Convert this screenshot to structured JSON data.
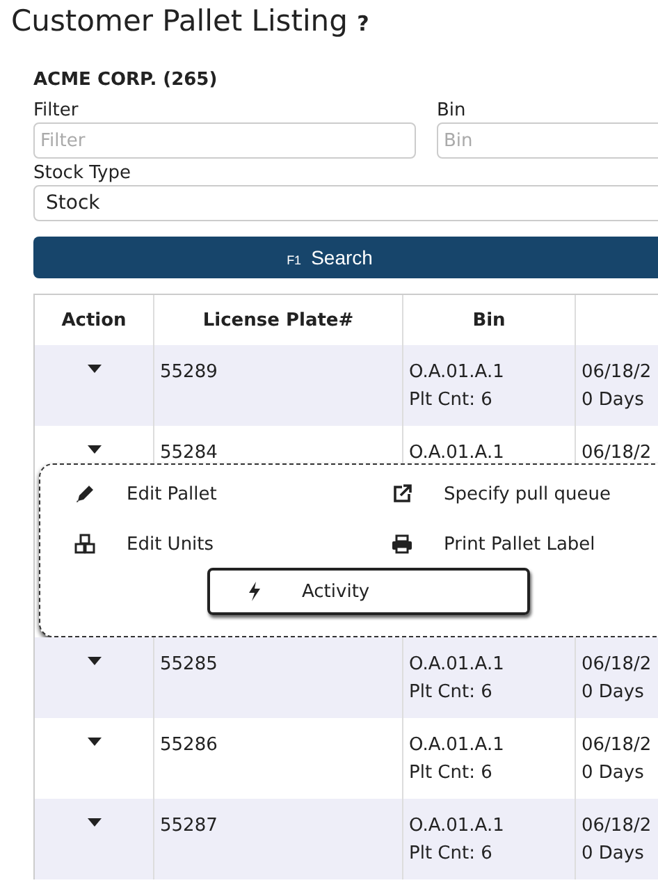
{
  "title": "Customer Pallet Listing",
  "help": "?",
  "customer": "ACME CORP. (265)",
  "filters": {
    "filter": {
      "label": "Filter",
      "placeholder": "Filter"
    },
    "bin": {
      "label": "Bin",
      "placeholder": "Bin"
    },
    "stock_type": {
      "label": "Stock Type",
      "value": "Stock"
    }
  },
  "search_button": {
    "key": "F1",
    "label": "Search"
  },
  "table": {
    "columns": [
      "Action",
      "License Plate#",
      "Bin"
    ],
    "rows": [
      {
        "plate": "55289",
        "bin": "O.A.01.A.1",
        "count": "Plt Cnt: 6",
        "date": "06/18/2",
        "age": "0 Days",
        "expanded": false
      },
      {
        "plate": "55284",
        "bin": "O.A.01.A.1",
        "date": "06/18/2",
        "expanded": true
      },
      {
        "plate": "55285",
        "bin": "O.A.01.A.1",
        "count": "Plt Cnt: 6",
        "date": "06/18/2",
        "age": "0 Days",
        "expanded": false
      },
      {
        "plate": "55286",
        "bin": "O.A.01.A.1",
        "count": "Plt Cnt: 6",
        "date": "06/18/2",
        "age": "0 Days",
        "expanded": false
      },
      {
        "plate": "55287",
        "bin": "O.A.01.A.1",
        "count": "Plt Cnt: 6",
        "date": "06/18/2",
        "age": "0 Days",
        "expanded": false
      }
    ]
  },
  "action_menu": [
    {
      "kind": "edit",
      "label": "Edit Pallet",
      "selected": false
    },
    {
      "kind": "link",
      "label": "Specify pull queue",
      "selected": false
    },
    {
      "kind": "units",
      "label": "Edit Units",
      "selected": false
    },
    {
      "kind": "print",
      "label": "Print Pallet Label",
      "selected": false
    },
    {
      "kind": "activity",
      "label": "Activity",
      "selected": true
    }
  ]
}
